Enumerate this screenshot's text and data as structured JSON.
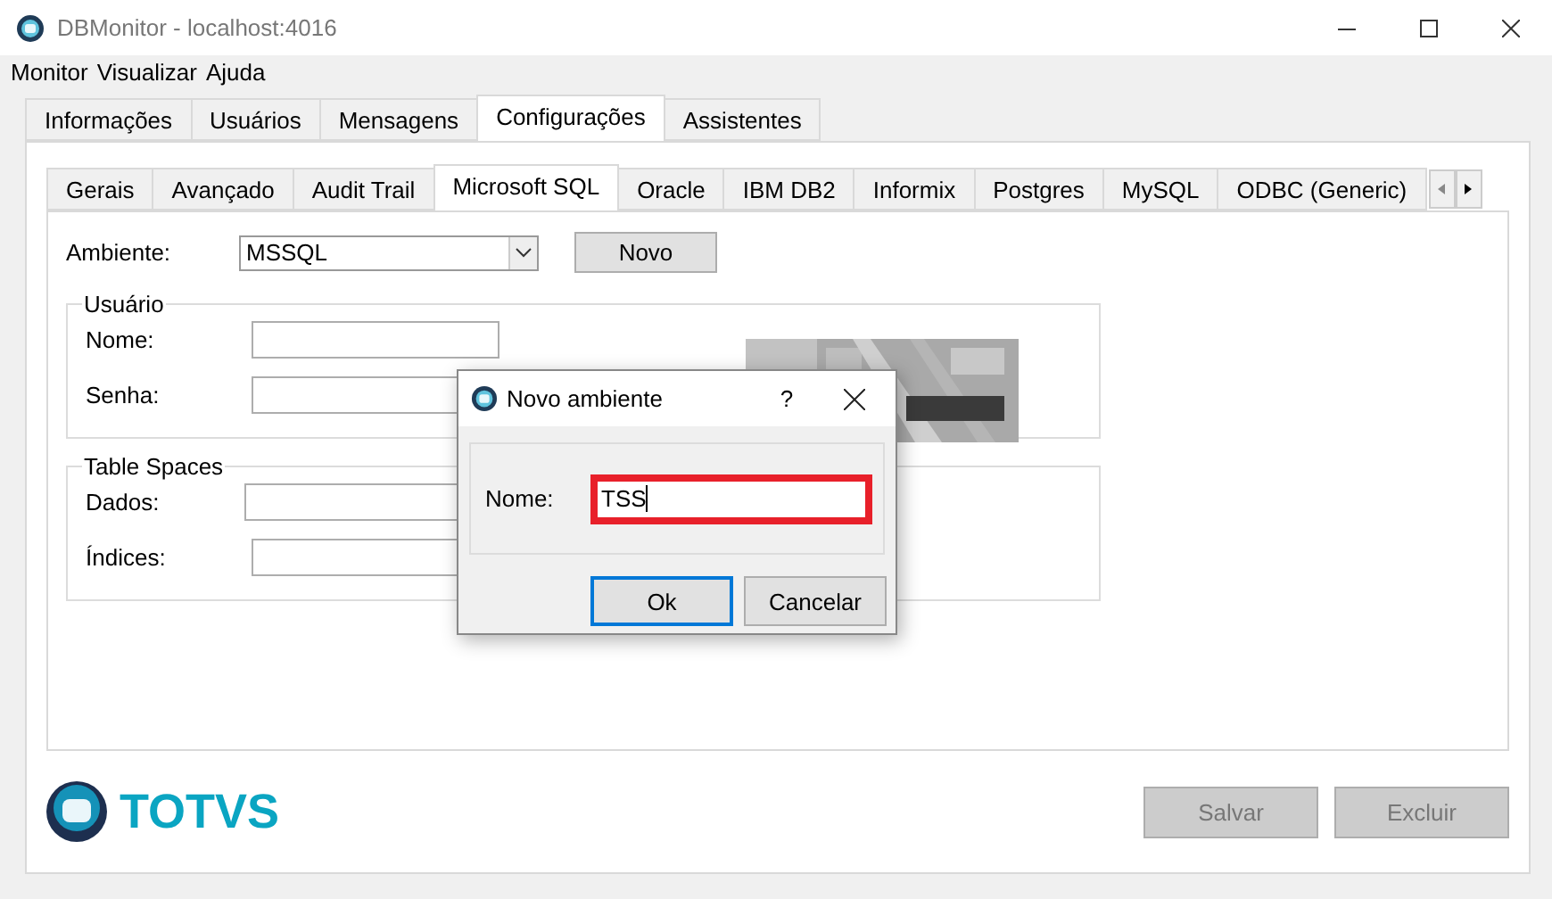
{
  "window": {
    "title": "DBMonitor - localhost:4016"
  },
  "menu": [
    "Monitor",
    "Visualizar",
    "Ajuda"
  ],
  "tabs": [
    {
      "label": "Informações",
      "selected": false
    },
    {
      "label": "Usuários",
      "selected": false
    },
    {
      "label": "Mensagens",
      "selected": false
    },
    {
      "label": "Configurações",
      "selected": true
    },
    {
      "label": "Assistentes",
      "selected": false
    }
  ],
  "subtabs": [
    {
      "label": "Gerais",
      "selected": false
    },
    {
      "label": "Avançado",
      "selected": false
    },
    {
      "label": "Audit Trail",
      "selected": false
    },
    {
      "label": "Microsoft SQL",
      "selected": true
    },
    {
      "label": "Oracle",
      "selected": false
    },
    {
      "label": "IBM DB2",
      "selected": false
    },
    {
      "label": "Informix",
      "selected": false
    },
    {
      "label": "Postgres",
      "selected": false
    },
    {
      "label": "MySQL",
      "selected": false
    },
    {
      "label": "ODBC (Generic)",
      "selected": false
    }
  ],
  "ambiente": {
    "label": "Ambiente:",
    "value": "MSSQL",
    "button": "Novo"
  },
  "groups": [
    {
      "title": "Usuário",
      "fields": [
        {
          "label": "Nome:"
        },
        {
          "label": "Senha:"
        }
      ],
      "kind": "picture"
    },
    {
      "title": "Table Spaces",
      "fields": [
        {
          "label": "Dados:"
        },
        {
          "label": "Índices:"
        }
      ]
    }
  ],
  "logo": "TOTVS",
  "buttons": [
    {
      "label": "Salvar",
      "disabled": true
    },
    {
      "label": "Excluir",
      "disabled": true
    }
  ],
  "dialog": {
    "title": "Novo ambiente",
    "help": "?",
    "field": {
      "label": "Nome:",
      "value": "TSS",
      "highlighted": true
    },
    "buttons": [
      {
        "label": "Ok",
        "default": true
      },
      {
        "label": "Cancelar",
        "default": false
      }
    ]
  }
}
